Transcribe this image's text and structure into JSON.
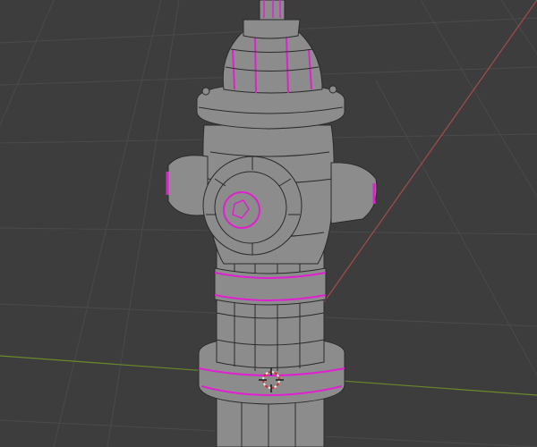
{
  "viewport": {
    "mode": "edit-mode-3d-viewport",
    "object": "fire-hydrant-mesh",
    "colors": {
      "background": "#3d3d3d",
      "grid": "#4a4a4a",
      "x_axis": "#a84a4a",
      "y_axis": "#6a8a2a",
      "mesh_fill": "#8c8c8c",
      "wire": "#2a2a2a",
      "seam": "#e020d0"
    }
  }
}
